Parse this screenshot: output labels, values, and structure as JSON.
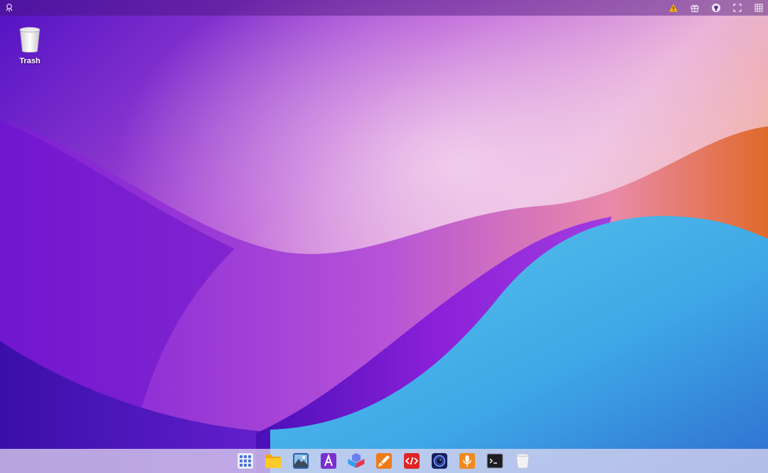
{
  "topbar": {
    "left_icon": "app-launcher-logo-icon",
    "right_icons": [
      "warning-icon",
      "gift-icon",
      "github-icon",
      "fullscreen-icon",
      "menu-grid-icon"
    ]
  },
  "desktop_icons": [
    {
      "label": "Trash",
      "icon": "trash-icon"
    }
  ],
  "dock": {
    "items": [
      "app-grid-icon",
      "file-manager-icon",
      "photos-icon",
      "font-app-icon",
      "cubes-app-icon",
      "paint-brush-app-icon",
      "code-editor-icon",
      "camera-app-icon",
      "voice-recorder-icon",
      "terminal-icon",
      "trash-icon"
    ]
  },
  "colors": {
    "warning": "#f5b400",
    "wallpaper_purple": "#7a24d8",
    "wallpaper_blue": "#3aa8e8",
    "wallpaper_orange": "#e57a2c"
  }
}
